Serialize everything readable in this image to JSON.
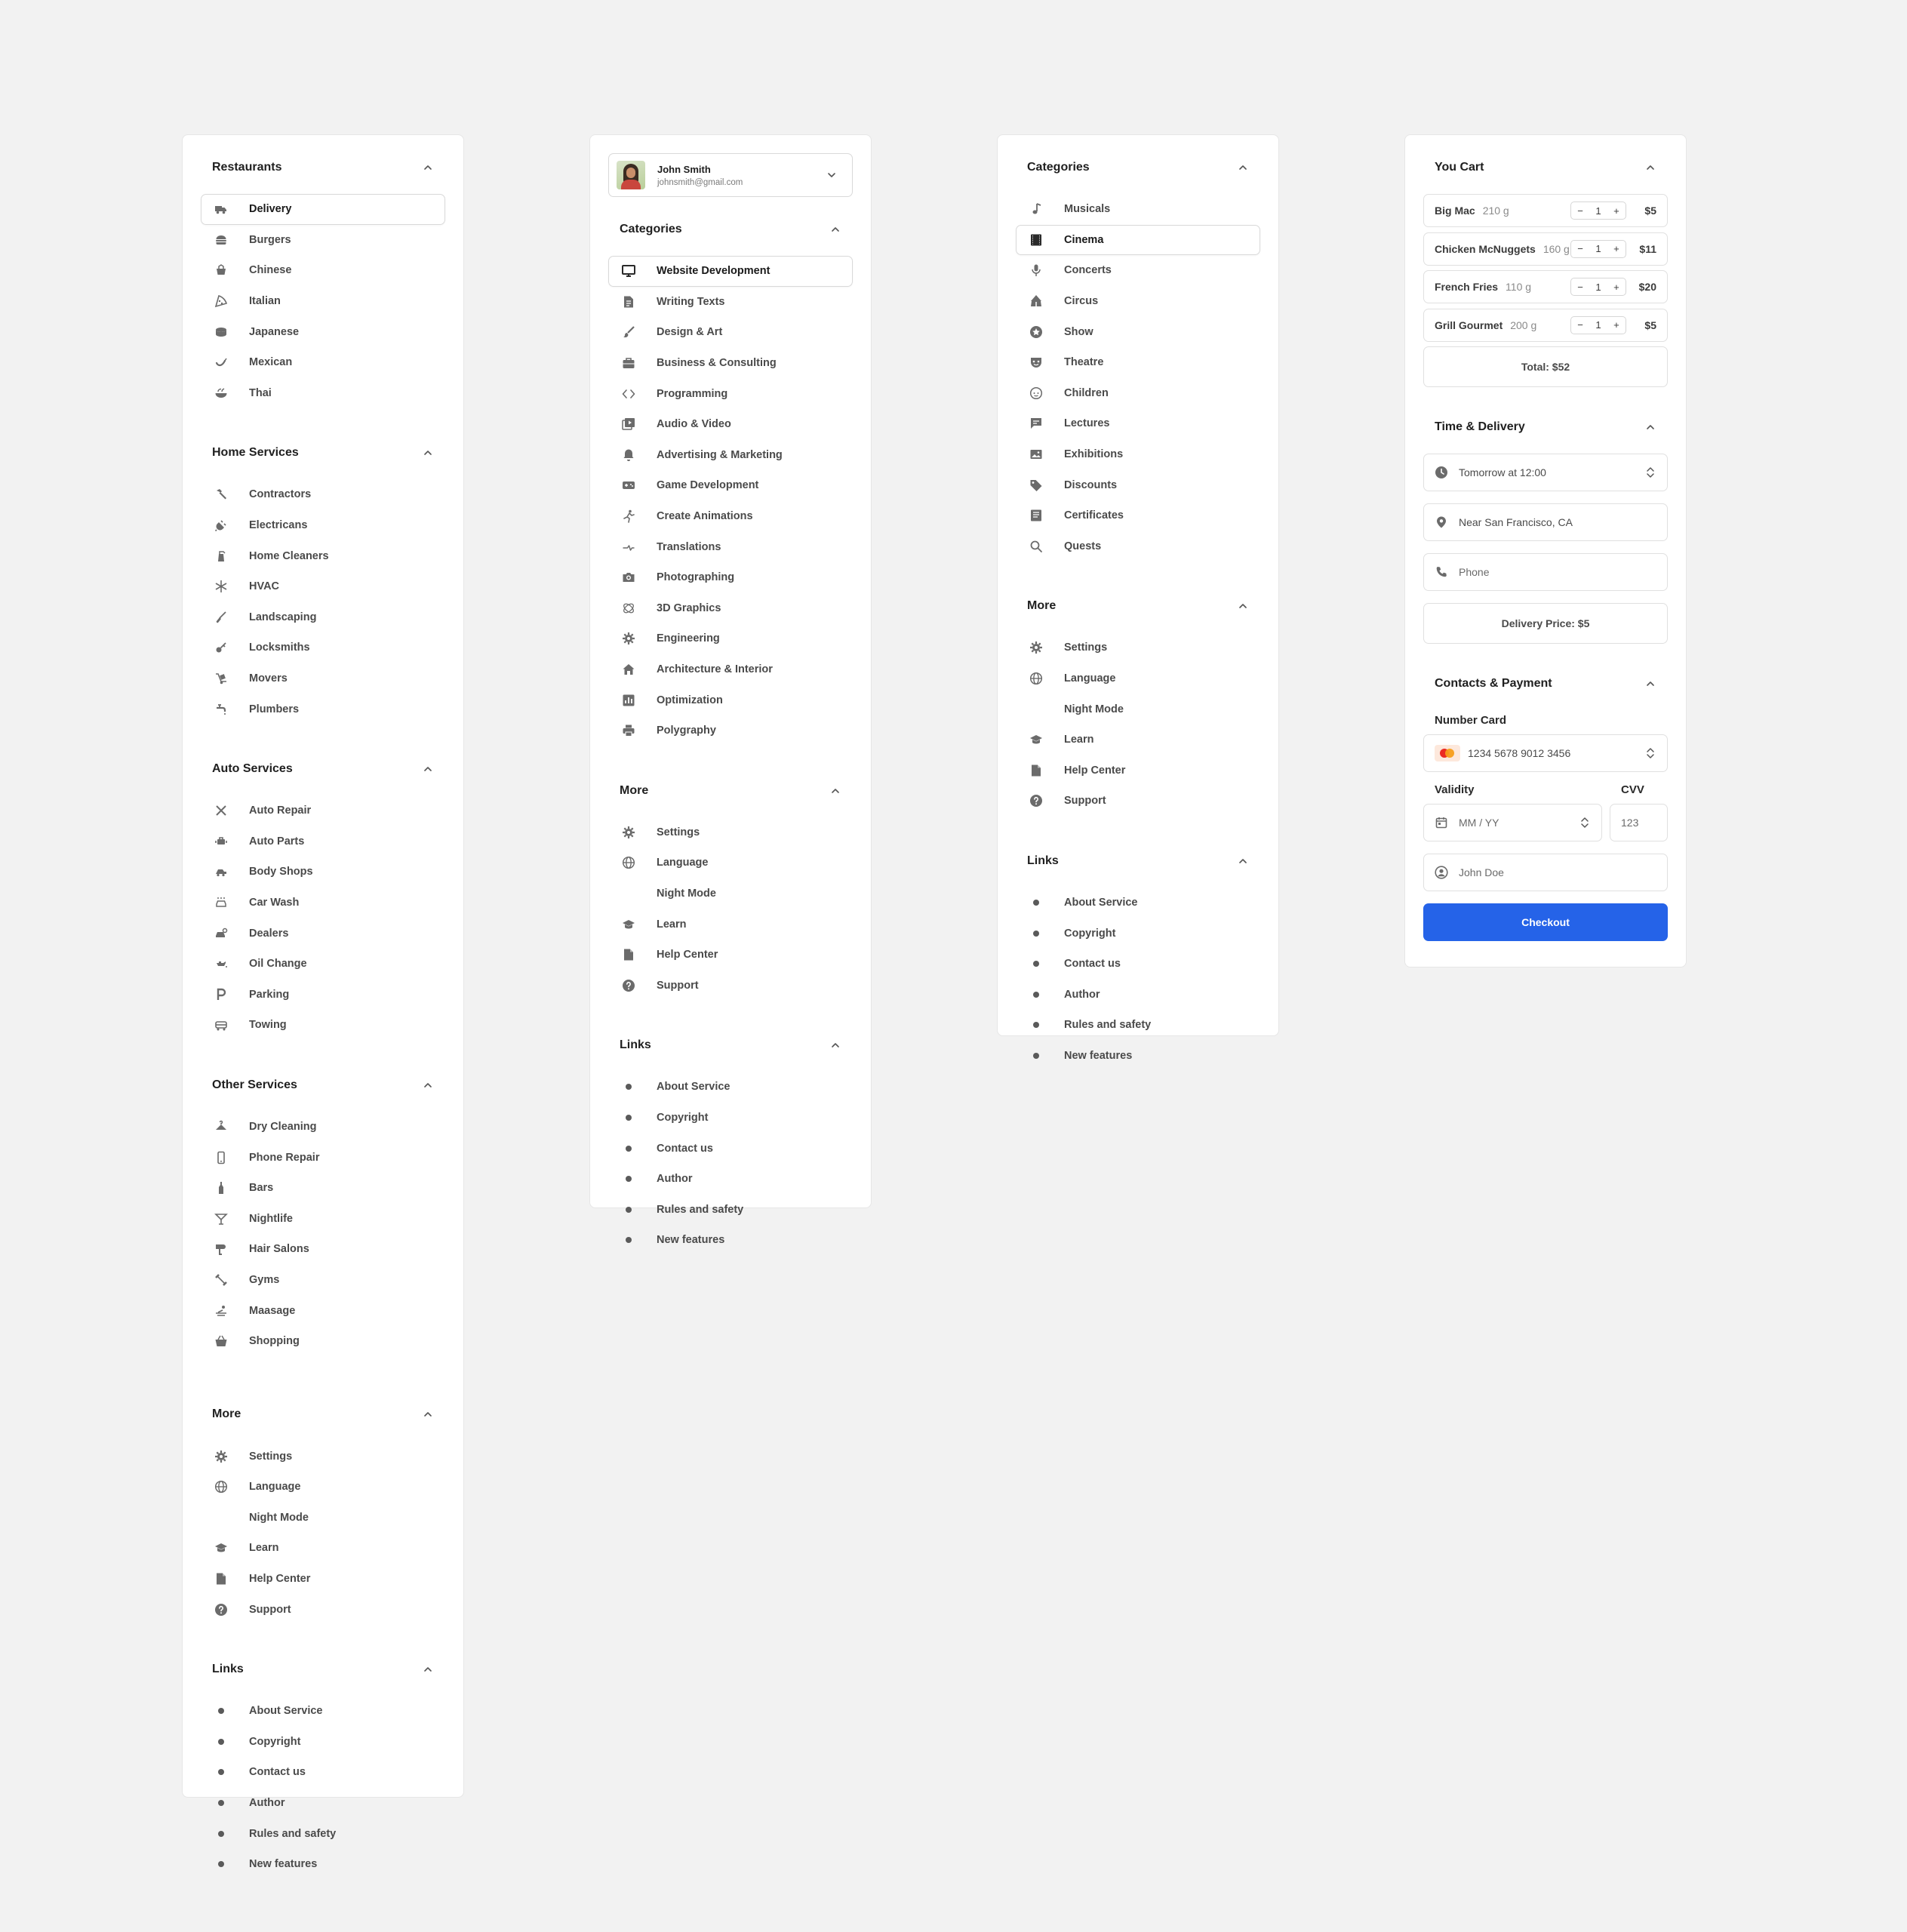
{
  "panel1": {
    "sections": [
      {
        "title": "Restaurants",
        "items": [
          {
            "label": "Delivery",
            "icon": "truck-icon",
            "active": true
          },
          {
            "label": "Burgers",
            "icon": "burger-icon"
          },
          {
            "label": "Chinese",
            "icon": "takeout-box-icon"
          },
          {
            "label": "Italian",
            "icon": "pizza-icon"
          },
          {
            "label": "Japanese",
            "icon": "sushi-icon"
          },
          {
            "label": "Mexican",
            "icon": "chili-icon"
          },
          {
            "label": "Thai",
            "icon": "bowl-icon"
          }
        ]
      },
      {
        "title": "Home Services",
        "items": [
          {
            "label": "Contractors",
            "icon": "hammer-icon"
          },
          {
            "label": "Electricans",
            "icon": "plug-icon"
          },
          {
            "label": "Home Cleaners",
            "icon": "spray-bottle-icon"
          },
          {
            "label": "HVAC",
            "icon": "snowflake-icon"
          },
          {
            "label": "Landscaping",
            "icon": "shovel-icon"
          },
          {
            "label": "Locksmiths",
            "icon": "key-icon"
          },
          {
            "label": "Movers",
            "icon": "dolly-icon"
          },
          {
            "label": "Plumbers",
            "icon": "faucet-icon"
          }
        ]
      },
      {
        "title": "Auto Services",
        "items": [
          {
            "label": "Auto Repair",
            "icon": "wrench-screwdriver-icon"
          },
          {
            "label": "Auto Parts",
            "icon": "engine-icon"
          },
          {
            "label": "Body Shops",
            "icon": "car-crash-icon"
          },
          {
            "label": "Car Wash",
            "icon": "car-wash-icon"
          },
          {
            "label": "Dealers",
            "icon": "car-key-icon"
          },
          {
            "label": "Oil Change",
            "icon": "oil-can-icon"
          },
          {
            "label": "Parking",
            "icon": "parking-icon"
          },
          {
            "label": "Towing",
            "icon": "tow-truck-icon"
          }
        ]
      },
      {
        "title": "Other Services",
        "items": [
          {
            "label": "Dry Cleaning",
            "icon": "hanger-icon"
          },
          {
            "label": "Phone Repair",
            "icon": "phone-icon"
          },
          {
            "label": "Bars",
            "icon": "bottle-icon"
          },
          {
            "label": "Nightlife",
            "icon": "cocktail-icon"
          },
          {
            "label": "Hair Salons",
            "icon": "hair-dryer-icon"
          },
          {
            "label": "Gyms",
            "icon": "dumbbell-icon"
          },
          {
            "label": "Maasage",
            "icon": "spa-icon"
          },
          {
            "label": "Shopping",
            "icon": "basket-icon"
          }
        ]
      },
      {
        "title": "More",
        "items": [
          {
            "label": "Settings",
            "icon": "gear-icon"
          },
          {
            "label": "Language",
            "icon": "globe-icon"
          },
          {
            "label": "Night Mode",
            "icon": "moon-icon"
          },
          {
            "label": "Learn",
            "icon": "graduation-cap-icon"
          },
          {
            "label": "Help Center",
            "icon": "document-icon"
          },
          {
            "label": "Support",
            "icon": "question-icon"
          }
        ]
      },
      {
        "title": "Links",
        "items": [
          {
            "label": "About Service",
            "icon": "bullet-icon"
          },
          {
            "label": "Copyright",
            "icon": "bullet-icon"
          },
          {
            "label": "Contact us",
            "icon": "bullet-icon"
          },
          {
            "label": "Author",
            "icon": "bullet-icon"
          },
          {
            "label": "Rules and safety",
            "icon": "bullet-icon"
          },
          {
            "label": "New features",
            "icon": "bullet-icon"
          }
        ]
      }
    ]
  },
  "panel2": {
    "user": {
      "name": "John Smith",
      "email": "johnsmith@gmail.com"
    },
    "sections": [
      {
        "title": "Categories",
        "items": [
          {
            "label": "Website Development",
            "icon": "monitor-icon",
            "active": true
          },
          {
            "label": "Writing Texts",
            "icon": "document-text-icon"
          },
          {
            "label": "Design & Art",
            "icon": "brush-icon"
          },
          {
            "label": "Business & Consulting",
            "icon": "briefcase-icon"
          },
          {
            "label": "Programming",
            "icon": "code-icon"
          },
          {
            "label": "Audio & Video",
            "icon": "media-icon"
          },
          {
            "label": "Advertising & Marketing",
            "icon": "bell-icon"
          },
          {
            "label": "Game Development",
            "icon": "gamepad-icon"
          },
          {
            "label": "Create Animations",
            "icon": "running-figure-icon"
          },
          {
            "label": "Translations",
            "icon": "translate-icon"
          },
          {
            "label": "Photographing",
            "icon": "camera-icon"
          },
          {
            "label": "3D Graphics",
            "icon": "3d-rotate-icon"
          },
          {
            "label": "Engineering",
            "icon": "gear-icon"
          },
          {
            "label": "Architecture & Interior",
            "icon": "home-icon"
          },
          {
            "label": "Optimization",
            "icon": "chart-icon"
          },
          {
            "label": "Polygraphy",
            "icon": "printer-icon"
          }
        ]
      },
      {
        "title": "More",
        "items": [
          {
            "label": "Settings",
            "icon": "gear-icon"
          },
          {
            "label": "Language",
            "icon": "globe-icon"
          },
          {
            "label": "Night Mode",
            "icon": "moon-icon"
          },
          {
            "label": "Learn",
            "icon": "graduation-cap-icon"
          },
          {
            "label": "Help Center",
            "icon": "document-icon"
          },
          {
            "label": "Support",
            "icon": "question-icon"
          }
        ]
      },
      {
        "title": "Links",
        "items": [
          {
            "label": "About Service",
            "icon": "bullet-icon"
          },
          {
            "label": "Copyright",
            "icon": "bullet-icon"
          },
          {
            "label": "Contact us",
            "icon": "bullet-icon"
          },
          {
            "label": "Author",
            "icon": "bullet-icon"
          },
          {
            "label": "Rules and safety",
            "icon": "bullet-icon"
          },
          {
            "label": "New features",
            "icon": "bullet-icon"
          }
        ]
      }
    ]
  },
  "panel3": {
    "sections": [
      {
        "title": "Categories",
        "items": [
          {
            "label": "Musicals",
            "icon": "music-note-icon"
          },
          {
            "label": "Cinema",
            "icon": "film-icon",
            "active": true
          },
          {
            "label": "Concerts",
            "icon": "microphone-icon"
          },
          {
            "label": "Circus",
            "icon": "circus-tent-icon"
          },
          {
            "label": "Show",
            "icon": "star-icon"
          },
          {
            "label": "Theatre",
            "icon": "mask-icon"
          },
          {
            "label": "Children",
            "icon": "child-face-icon"
          },
          {
            "label": "Lectures",
            "icon": "chat-icon"
          },
          {
            "label": "Exhibitions",
            "icon": "image-icon"
          },
          {
            "label": "Discounts",
            "icon": "tag-icon"
          },
          {
            "label": "Certificates",
            "icon": "certificate-icon"
          },
          {
            "label": "Quests",
            "icon": "search-icon"
          }
        ]
      },
      {
        "title": "More",
        "items": [
          {
            "label": "Settings",
            "icon": "gear-icon"
          },
          {
            "label": "Language",
            "icon": "globe-icon"
          },
          {
            "label": "Night Mode",
            "icon": "moon-icon"
          },
          {
            "label": "Learn",
            "icon": "graduation-cap-icon"
          },
          {
            "label": "Help Center",
            "icon": "document-icon"
          },
          {
            "label": "Support",
            "icon": "question-icon"
          }
        ]
      },
      {
        "title": "Links",
        "items": [
          {
            "label": "About Service",
            "icon": "bullet-icon"
          },
          {
            "label": "Copyright",
            "icon": "bullet-icon"
          },
          {
            "label": "Contact us",
            "icon": "bullet-icon"
          },
          {
            "label": "Author",
            "icon": "bullet-icon"
          },
          {
            "label": "Rules and safety",
            "icon": "bullet-icon"
          },
          {
            "label": "New features",
            "icon": "bullet-icon"
          }
        ]
      }
    ]
  },
  "cart": {
    "title": "You Cart",
    "items": [
      {
        "name": "Big Mac",
        "weight": "210 g",
        "qty": "1",
        "price": "$5"
      },
      {
        "name": "Chicken McNuggets",
        "weight": "160 g",
        "qty": "1",
        "price": "$11"
      },
      {
        "name": "French Fries",
        "weight": "110 g",
        "qty": "1",
        "price": "$20"
      },
      {
        "name": "Grill Gourmet",
        "weight": "200 g",
        "qty": "1",
        "price": "$5"
      }
    ],
    "minus": "−",
    "plus": "+",
    "total": "Total: $52",
    "delivery_title": "Time & Delivery",
    "time_value": "Tomorrow at 12:00",
    "location_value": "Near San Francisco, CA",
    "phone_placeholder": "Phone",
    "delivery_price": "Delivery Price: $5",
    "payment_title": "Contacts & Payment",
    "card_label": "Number Card",
    "card_number": "1234 5678 9012 3456",
    "validity_label": "Validity",
    "cvv_label": "CVV",
    "validity_placeholder": "MM / YY",
    "cvv_placeholder": "123",
    "name_placeholder": "John Doe",
    "checkout_label": "Checkout",
    "accent_color": "#2563e8"
  }
}
